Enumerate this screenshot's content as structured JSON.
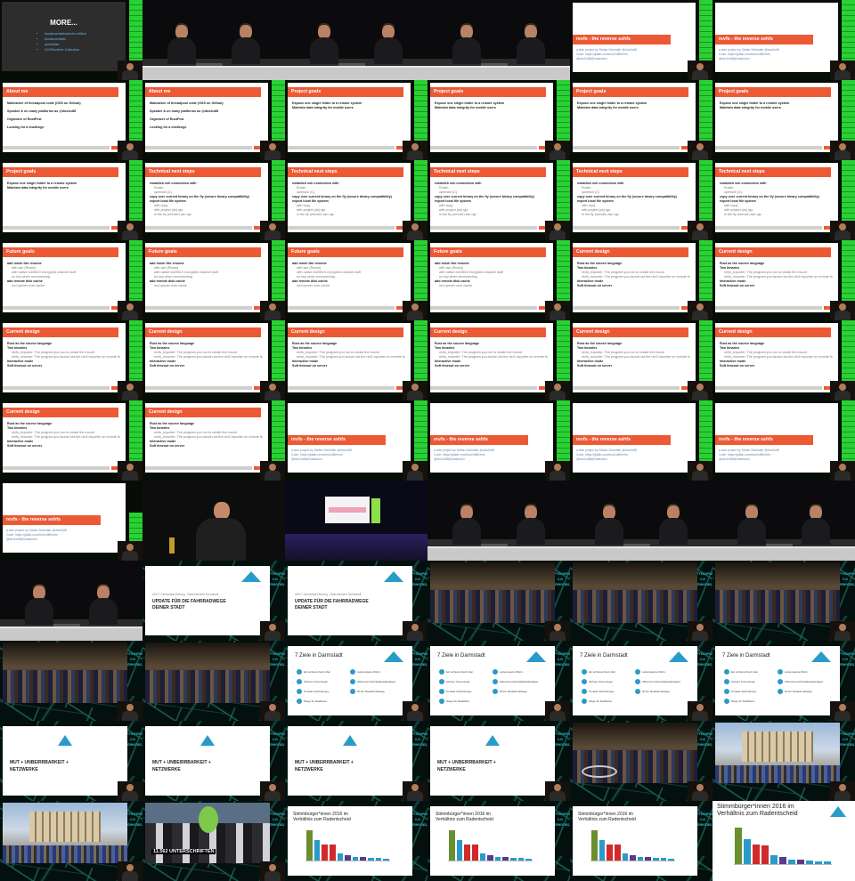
{
  "colors": {
    "accent": "#ec5a35",
    "term_green": "#22c22c",
    "slide_blue": "#2a9bc9",
    "bar_green": "#6a8f2e",
    "bar_blue": "#2a9bc9",
    "bar_red": "#d12a2a",
    "bar_purple": "#5a3a8a"
  },
  "slides": {
    "more_title": "MORE...",
    "more_items": [
      "fundamentals/server-edition",
      "fundamentals/",
      "quickstart",
      "DIY/Runtime Collection"
    ],
    "about": {
      "title": "About me",
      "items": [
        "Maintainer of threadpool crate (OSS on Github)",
        "Speaker & on many platforms as @dns2utf8",
        "Organizer of RustFest",
        "Looking for a challenge"
      ]
    },
    "goals": {
      "title": "Project goals",
      "items": [
        "Expose one single folder to a remote system",
        "Maintain data integrity for mobile users"
      ]
    },
    "technical": {
      "title": "Technical next steps",
      "items": [
        "establish ssh connection with",
        "copy over current binary on the fly (secure binary compatibility)",
        "export local file system"
      ],
      "subs": [
        "Russh",
        "openssh (C)",
        "with copy",
        "with project (ok) rgs",
        "in the fly (remote) ssh rgs"
      ]
    },
    "future": {
      "title": "Future goals",
      "items": [
        "add mosh like resume",
        "add remote disk cache"
      ],
      "subs": [
        "with ssh (Russh)",
        "with native ed25519 encrypted channel stuff",
        "no key when reconnecting",
        "incl opener over cache"
      ]
    },
    "design": {
      "title": "Current design",
      "items": [
        "Rust as the source language",
        "Two binaries",
        "Interactive mode",
        "Soft timeout on server"
      ],
      "subs": [
        "revfs_exporter: The program you run to create the mount",
        "revfs_mounter: The program you launch via the rsh2 exporter on remote fs"
      ]
    },
    "revfs": {
      "title": "revfs - the reverse sshfs",
      "meta": [
        "a side project by Stefan Schindler @dns2utf8",
        "Code: https://gitlab.com/dns2utf8/revfs",
        "@dns2utf8@mastodon"
      ]
    },
    "fahrrad": {
      "meta": "ADFC Darmstadt-Dieburg · Radentscheid Darmstadt",
      "line1": "UPDATE FÜR DIE FAHRRADWEGE",
      "line2": "DEINER STADT"
    },
    "ziele": {
      "title": "7 Ziele in Darmstadt",
      "items": [
        "Ein sicheres Netz über",
        "Sichere Kreuzungen",
        "5 lokale Verbindungs-",
        "Wege für Radfahrer",
        "Lebenswerte Wohn-",
        "Offensive Fahrradabstellanlagen",
        "20 km Radschnellwege"
      ]
    },
    "mut": {
      "line1": "MUT + UNBEIRRBARKEIT +",
      "line2": "NETZWERKE"
    },
    "unterschriften": "11.562 UNTERSCHRIFTEN",
    "stimm": {
      "title_line1": "Stimmbürger*innen 2016 im",
      "title_line2": "Verhältnis zum Radentscheid"
    }
  },
  "logo_text": [
    "PPYSCHPING",
    "X-IX",
    "INGWOTIES"
  ]
}
